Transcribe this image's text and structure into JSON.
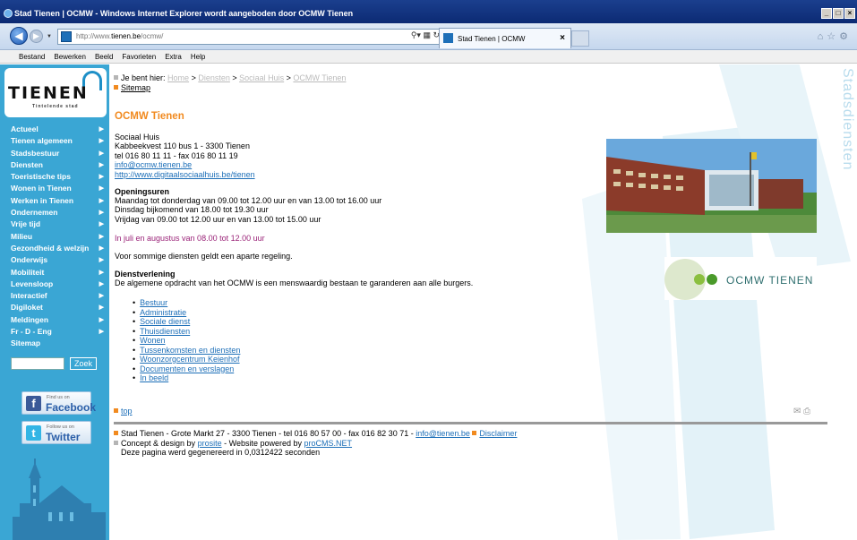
{
  "browser": {
    "title": "Stad Tienen | OCMW - Windows Internet Explorer wordt aangeboden door OCMW Tienen",
    "url_prefix": "http://www.",
    "url_domain": "tienen.be",
    "url_path": "/ocmw/",
    "tab_label": "Stad Tienen | OCMW",
    "menu": [
      "Bestand",
      "Bewerken",
      "Beeld",
      "Favorieten",
      "Extra",
      "Help"
    ]
  },
  "logo": {
    "word": "TIENEN",
    "tagline": "Tintelende stad"
  },
  "leftnav": [
    "Actueel",
    "Tienen algemeen",
    "Stadsbestuur",
    "Diensten",
    "Toeristische tips",
    "Wonen in Tienen",
    "Werken in Tienen",
    "Ondernemen",
    "Vrije tijd",
    "Milieu",
    "Gezondheid & welzijn",
    "Onderwijs",
    "Mobiliteit",
    "Levensloop",
    "Interactief",
    "Digiloket",
    "Meldingen",
    "Fr - D - Eng",
    "Sitemap"
  ],
  "search": {
    "button": "Zoek"
  },
  "social": {
    "facebook_small": "Find us on",
    "facebook_big": "Facebook",
    "twitter_small": "Follow us on",
    "twitter_big": "Twitter"
  },
  "vertical_text": "Stadsdiensten",
  "breadcrumb": {
    "prefix": "Je bent hier:",
    "items": [
      "Home",
      "Diensten",
      "Sociaal Huis",
      "OCMW Tienen"
    ],
    "sitemap": "Sitemap"
  },
  "main": {
    "title": "OCMW Tienen",
    "address_lines": [
      "Sociaal Huis",
      "Kabbeekvest 110 bus 1 - 3300 Tienen",
      "tel 016 80 11 11 - fax 016 80 11 19"
    ],
    "email": "info@ocmw.tienen.be",
    "website": "http://www.digitaalsociaalhuis.be/tienen",
    "opening_title": "Openingsuren",
    "opening_lines": [
      "Maandag tot donderdag van 09.00 tot 12.00 uur en van 13.00 tot 16.00 uur",
      "Dinsdag bijkomend van 18.00 tot 19.30 uur",
      "Vrijdag van 09.00 tot 12.00 uur en van 13.00 tot 15.00 uur"
    ],
    "summer": "In juli en augustus van 08.00 tot 12.00 uur",
    "other": "Voor sommige diensten geldt een aparte regeling.",
    "service_title": "Dienstverlening",
    "service_text": "De algemene opdracht van het OCMW is een menswaardig bestaan te garanderen aan alle burgers.",
    "links": [
      "Bestuur",
      "Administratie",
      "Sociale dienst",
      "Thuisdiensten",
      "Wonen",
      "Tussenkomsten en diensten",
      "Woonzorgcentrum Keienhof",
      "Documenten en verslagen",
      "In beeld"
    ],
    "ocmw_logo_text": "OCMW TIENEN",
    "top_link": "top"
  },
  "footer": {
    "line1": "Stad Tienen - Grote Markt 27 - 3300 Tienen - tel 016 80 57 00 - fax 016 82 30 71 -",
    "email": "info@tienen.be",
    "disclaimer": "Disclaimer",
    "concept_prefix": "Concept & design by",
    "concept_link": "prosite",
    "powered_prefix": "- Website powered by",
    "powered_link": "proCMS.NET",
    "generated": "Deze pagina werd gegenereerd in 0,0312422 seconden"
  },
  "colors": {
    "sidebar": "#3aa6d4",
    "accent": "#f18a1f",
    "summer": "#9a2378",
    "link": "#1d6fb8"
  }
}
